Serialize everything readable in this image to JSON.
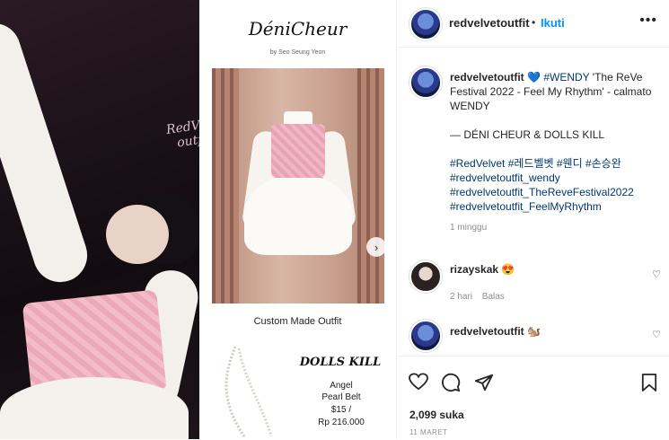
{
  "post": {
    "username": "redvelvetoutfit",
    "follow_label": "Ikuti",
    "more_label": "•••",
    "separator": "•",
    "caption_emoji": "💙",
    "caption_tag": "#WENDY",
    "caption_title": "'The ReVe Festival 2022 - Feel My Rhythm' - calmato WENDY",
    "caption_credit": "— DÉNI CHEUR & DOLLS KILL",
    "hashtags": [
      "#RedVelvet #레드벨벳 #웬디 #손승완",
      "#redvelvetoutfit_wendy",
      "#redvelvetoutfit_TheReveFestival2022",
      "#redvelvetoutfit_FeelMyRhythm"
    ],
    "caption_time": "1 minggu",
    "likes": "2,099 suka",
    "date": "11 MARET"
  },
  "comments": [
    {
      "user": "rizayskak",
      "emoji": "😍",
      "time": "2 hari",
      "reply_label": "Balas"
    },
    {
      "user": "redvelvetoutfit",
      "emoji": "🐿️"
    }
  ],
  "media": {
    "watermark_line1": "RedVelvet",
    "watermark_line2": "outfit",
    "brand1": "DéniCheur",
    "brand1_sub": "by Seo Seung Yeon",
    "caption1": "Custom Made Outfit",
    "brand2": "DOLLS KILL",
    "product_name_line1": "Angel",
    "product_name_line2": "Pearl Belt",
    "price_usd": "$15 /",
    "price_idr": "Rp 216.000"
  },
  "icons": {
    "heart": "heart-icon",
    "comment": "comment-icon",
    "share": "share-icon",
    "bookmark": "bookmark-icon",
    "next": "chevron-right-icon"
  },
  "colors": {
    "link": "#00376b",
    "follow": "#0095f6",
    "accent_pink": "#f0b6c4"
  }
}
